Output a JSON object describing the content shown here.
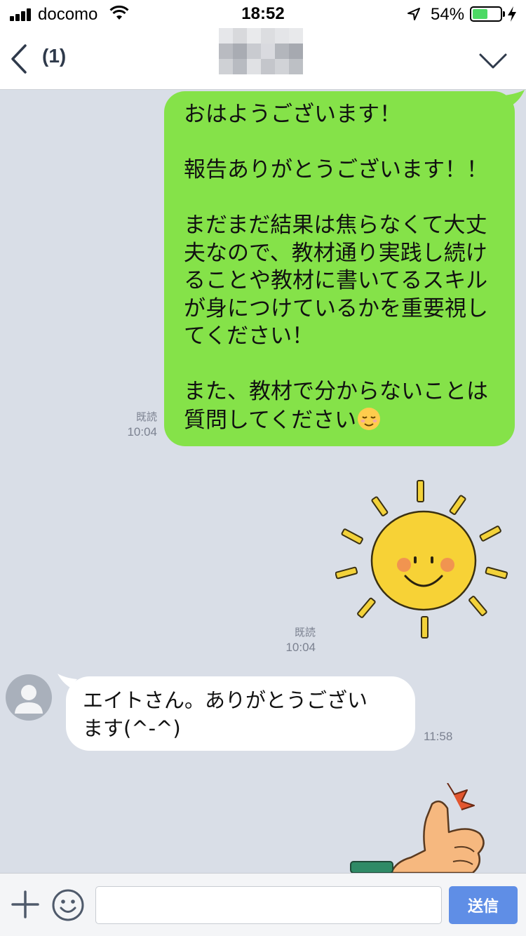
{
  "status_bar": {
    "carrier": "docomo",
    "time": "18:52",
    "battery_percent": "54%",
    "battery_level": 0.54,
    "battery_color": "#4cd964"
  },
  "nav": {
    "back_icon": "chevron-left-icon",
    "unread_count": "(1)",
    "menu_icon": "chevron-down-icon"
  },
  "messages": [
    {
      "direction": "outgoing",
      "text": "おはようございます！\n\n報告ありがとうございます！！\n\nまだまだ結果は焦らなくて大丈\n夫なので、教材通り実践し続け\nることや教材に書いてるスキル\nが身につけているかを重要視し\nてください！\n\nまた、教材で分からないことは\n質問してください",
      "emoji": "relieved-face",
      "read_label": "既読",
      "time": "10:04",
      "bubble_color": "#85e249"
    },
    {
      "direction": "outgoing",
      "type": "sticker",
      "sticker": "smiling-sun",
      "read_label": "既読",
      "time": "10:04"
    },
    {
      "direction": "incoming",
      "text": "エイトさん。ありがとうござい\nます(^-^)",
      "time": "11:58",
      "bubble_color": "#ffffff"
    },
    {
      "direction": "incoming",
      "type": "sticker",
      "sticker": "thumbs-up"
    }
  ],
  "input_bar": {
    "plus_icon": "plus-icon",
    "emoji_icon": "smiley-icon",
    "input_value": "",
    "send_label": "送信",
    "send_color": "#5f8ee6"
  },
  "colors": {
    "chat_background": "#d9dee7",
    "meta_text": "#7b8190"
  }
}
